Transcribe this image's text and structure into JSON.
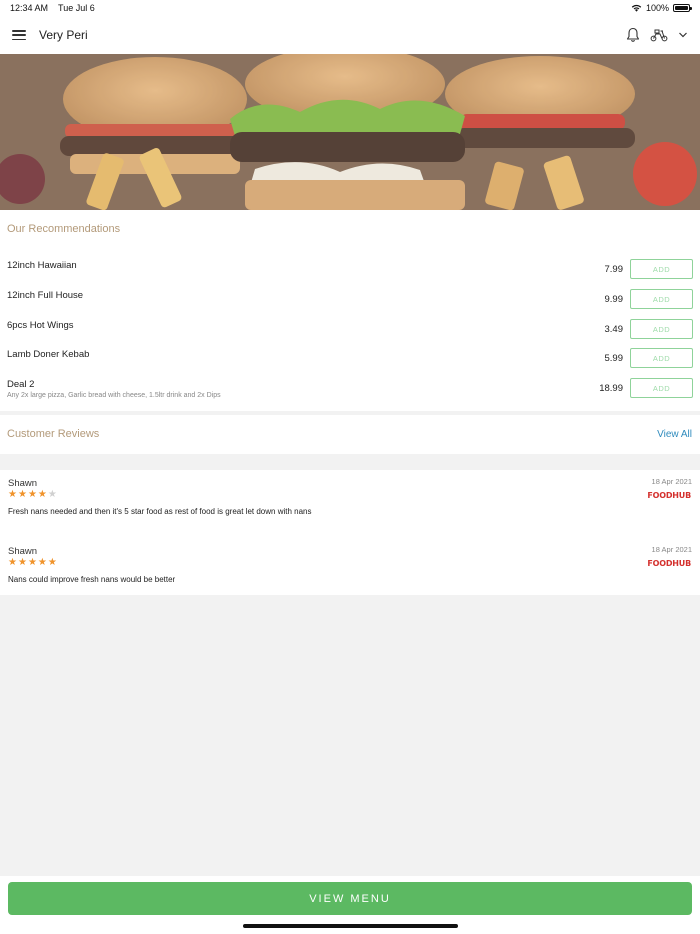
{
  "status_bar": {
    "time": "12:34 AM",
    "date": "Tue Jul 6",
    "battery": "100%",
    "wifi_icon": "wifi-icon",
    "battery_icon": "battery-icon"
  },
  "header": {
    "title": "Very Peri",
    "menu_icon": "hamburger-menu-icon",
    "bell_icon": "bell-icon",
    "delivery_icon": "scooter-icon",
    "chevron_icon": "chevron-down-icon"
  },
  "recommendations": {
    "title": "Our Recommendations",
    "add_label": "ADD",
    "items": [
      {
        "name": "12inch Hawaiian",
        "price": "7.99",
        "description": ""
      },
      {
        "name": "12inch Full House",
        "price": "9.99",
        "description": ""
      },
      {
        "name": "6pcs Hot Wings",
        "price": "3.49",
        "description": ""
      },
      {
        "name": "Lamb Doner Kebab",
        "price": "5.99",
        "description": ""
      },
      {
        "name": "Deal 2",
        "price": "18.99",
        "description": "Any 2x large pizza, Garlic bread with cheese, 1.5ltr drink and 2x Dips"
      }
    ]
  },
  "reviews": {
    "title": "Customer Reviews",
    "view_all": "View All",
    "items": [
      {
        "name": "Shawn",
        "rating": 4,
        "date": "18 Apr 2021",
        "source": "FOODHUB",
        "text": "Fresh nans needed and then it's 5 star food as rest of food is great let down with nans"
      },
      {
        "name": "Shawn",
        "rating": 5,
        "date": "18 Apr 2021",
        "source": "FOODHUB",
        "text": "Nans could improve fresh nans would be better"
      }
    ]
  },
  "footer": {
    "view_menu": "VIEW MENU"
  },
  "colors": {
    "accent_green": "#5cb962",
    "star_orange": "#f0932b",
    "star_gray": "#d0d0d0",
    "section_title": "#b39a7a",
    "link_blue": "#2f8bbd",
    "foodhub_red": "#d4312e"
  }
}
